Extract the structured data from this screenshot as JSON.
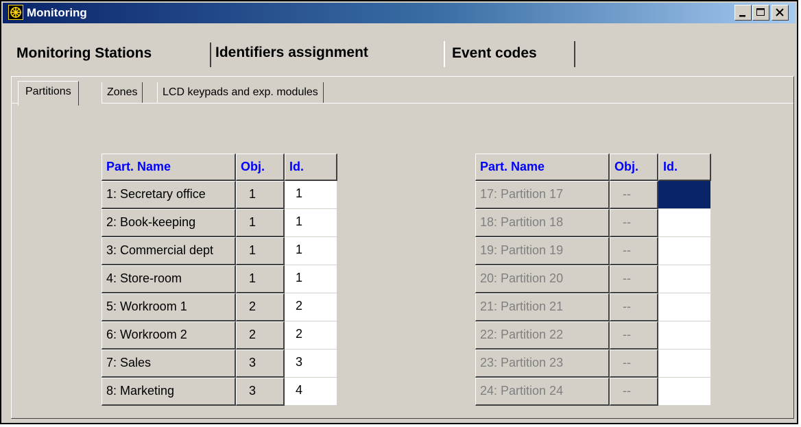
{
  "window": {
    "title": "Monitoring"
  },
  "tabs": [
    {
      "label": "Monitoring Stations",
      "active": false
    },
    {
      "label": "Identifiers assignment",
      "active": true
    },
    {
      "label": "Event codes",
      "active": false
    }
  ],
  "subtabs": [
    {
      "label": "Partitions",
      "active": true
    },
    {
      "label": "Zones",
      "active": false
    },
    {
      "label": "LCD keypads and exp. modules",
      "active": false
    }
  ],
  "columns": {
    "name": "Part. Name",
    "obj": "Obj.",
    "id": "Id."
  },
  "left_table": [
    {
      "name": "1: Secretary office",
      "obj": "1",
      "id": "1"
    },
    {
      "name": "2: Book-keeping",
      "obj": "1",
      "id": "1"
    },
    {
      "name": "3: Commercial dept",
      "obj": "1",
      "id": "1"
    },
    {
      "name": "4: Store-room",
      "obj": "1",
      "id": "1"
    },
    {
      "name": "5: Workroom 1",
      "obj": "2",
      "id": "2"
    },
    {
      "name": "6: Workroom 2",
      "obj": "2",
      "id": "2"
    },
    {
      "name": "7: Sales",
      "obj": "3",
      "id": "3"
    },
    {
      "name": "8: Marketing",
      "obj": "3",
      "id": "4"
    }
  ],
  "right_table": [
    {
      "name": "17: Partition 17",
      "obj": "--",
      "id": "",
      "selected": true
    },
    {
      "name": "18: Partition 18",
      "obj": "--",
      "id": ""
    },
    {
      "name": "19: Partition 19",
      "obj": "--",
      "id": ""
    },
    {
      "name": "20: Partition 20",
      "obj": "--",
      "id": ""
    },
    {
      "name": "21: Partition 21",
      "obj": "--",
      "id": ""
    },
    {
      "name": "22: Partition 22",
      "obj": "--",
      "id": ""
    },
    {
      "name": "23: Partition 23",
      "obj": "--",
      "id": ""
    },
    {
      "name": "24: Partition 24",
      "obj": "--",
      "id": ""
    }
  ],
  "colors": {
    "face": "#d4d0c8",
    "header_text": "#0000ff",
    "disabled_text": "#808080",
    "selection": "#0a246a",
    "titlebar_start": "#0a246a",
    "titlebar_end": "#a6caf0"
  },
  "icons": {
    "app": "monitoring-app-icon",
    "minimize": "minimize-icon",
    "maximize": "maximize-icon",
    "close": "close-icon"
  }
}
